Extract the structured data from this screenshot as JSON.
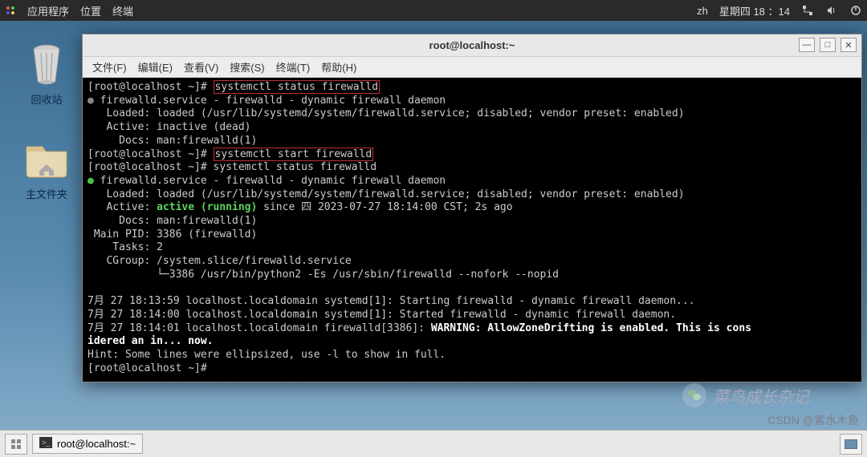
{
  "top_panel": {
    "apps": "应用程序",
    "places": "位置",
    "terminal": "终端",
    "lang": "zh",
    "datetime": "星期四 18 ：14"
  },
  "desktop": {
    "trash": "回收站",
    "home": "主文件夹"
  },
  "window": {
    "title": "root@localhost:~",
    "menu": {
      "file": "文件(F)",
      "edit": "编辑(E)",
      "view": "查看(V)",
      "search": "搜索(S)",
      "terminal": "终端(T)",
      "help": "帮助(H)"
    }
  },
  "term": {
    "prompt": "[root@localhost ~]# ",
    "cmd_status": "systemctl status firewalld",
    "cmd_start": "systemctl start firewalld",
    "svc_header": "firewalld.service - firewalld - dynamic firewall daemon",
    "loaded": "   Loaded: loaded (/usr/lib/systemd/system/firewalld.service; disabled; vendor preset: enabled)",
    "inactive": "   Active: inactive (dead)",
    "docs": "     Docs: man:firewalld(1)",
    "active_pre": "   Active: ",
    "active_val": "active (running)",
    "active_post": " since 四 2023-07-27 18:14:00 CST; 2s ago",
    "mainpid": " Main PID: 3386 (firewalld)",
    "tasks": "    Tasks: 2",
    "cgroup": "   CGroup: /system.slice/firewalld.service",
    "cgroup2": "           └─3386 /usr/bin/python2 -Es /usr/sbin/firewalld --nofork --nopid",
    "log1": "7月 27 18:13:59 localhost.localdomain systemd[1]: Starting firewalld - dynamic firewall daemon...",
    "log2": "7月 27 18:14:00 localhost.localdomain systemd[1]: Started firewalld - dynamic firewall daemon.",
    "log3a": "7月 27 18:14:01 localhost.localdomain firewalld[3386]: ",
    "log3b": "WARNING: AllowZoneDrifting is enabled. This is cons",
    "log3c": "idered an in... now.",
    "hint": "Hint: Some lines were ellipsized, use -l to show in full."
  },
  "taskbar": {
    "task1": "root@localhost:~"
  },
  "watermark": {
    "wechat": "菜鸟成长杂记",
    "csdn": "CSDN @紫水木鱼"
  }
}
